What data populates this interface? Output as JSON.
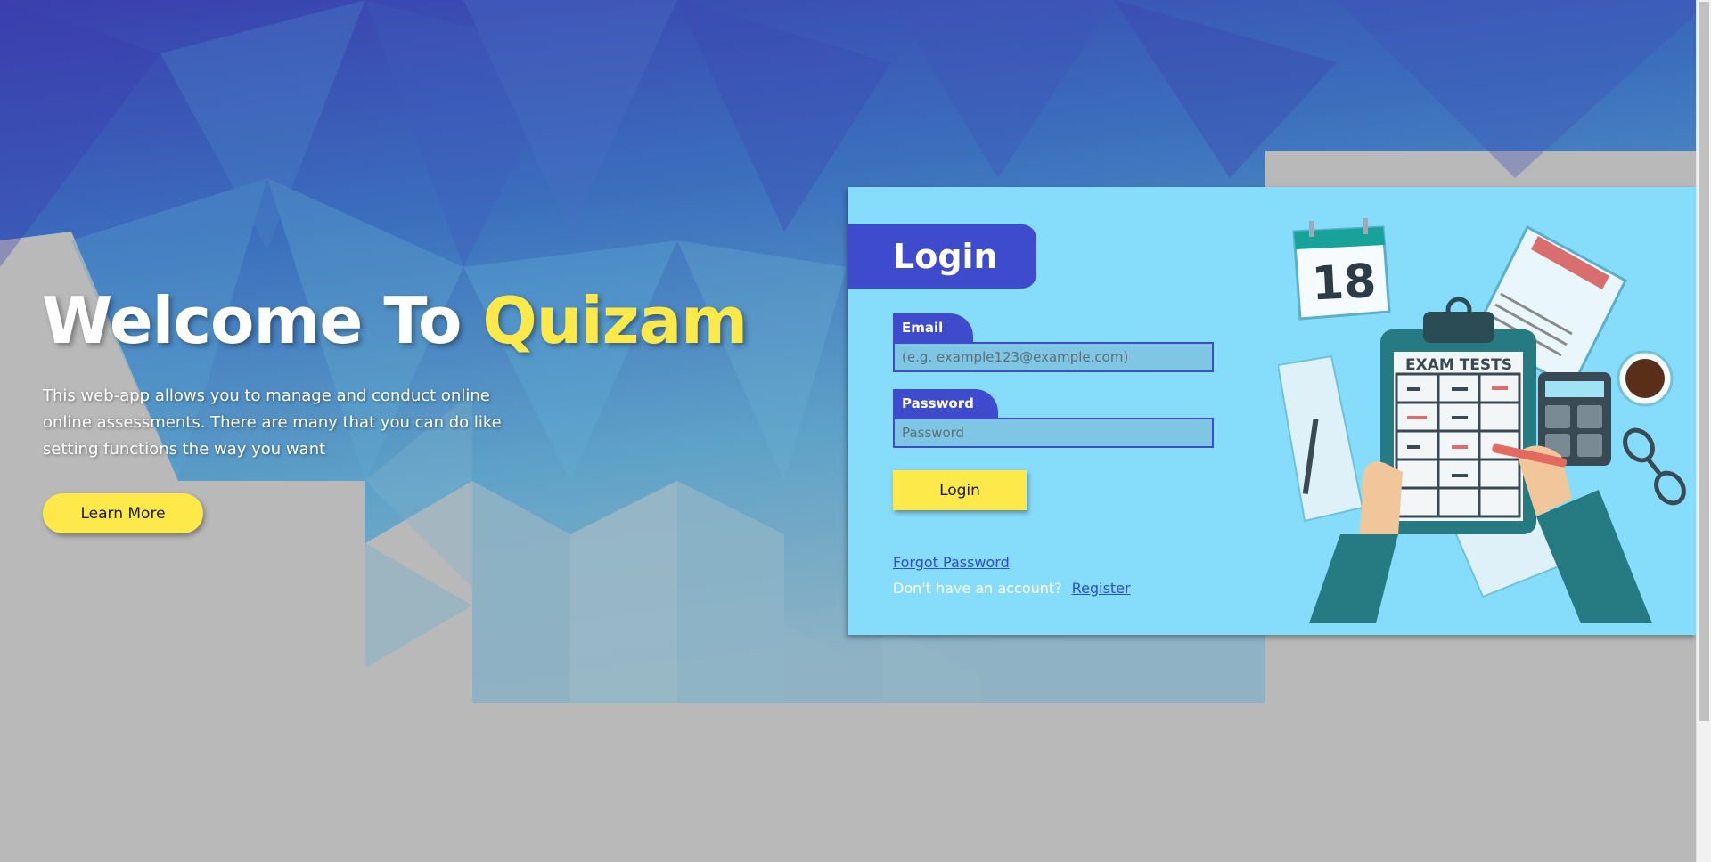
{
  "hero": {
    "title_prefix": "Welcome To ",
    "title_brand": "Quizam",
    "description": "This web-app allows you to manage and conduct online online assessments. There are many that you can do like setting functions the way you want",
    "learn_more_label": "Learn More"
  },
  "login": {
    "title": "Login",
    "email_label": "Email",
    "email_placeholder": "(e.g. example123@example.com)",
    "email_value": "",
    "password_label": "Password",
    "password_placeholder": "Password",
    "password_value": "",
    "submit_label": "Login",
    "forgot_label": "Forgot Password",
    "no_account_text": "Don't have an account?",
    "register_label": "Register"
  },
  "illustration": {
    "calendar_day": "18",
    "clipboard_title": "EXAM TESTS"
  },
  "colors": {
    "brand_yellow": "#fde94a",
    "primary_blue": "#3d4bcc",
    "card_bg": "#86dcfb",
    "page_gray": "#b9b9b9"
  }
}
